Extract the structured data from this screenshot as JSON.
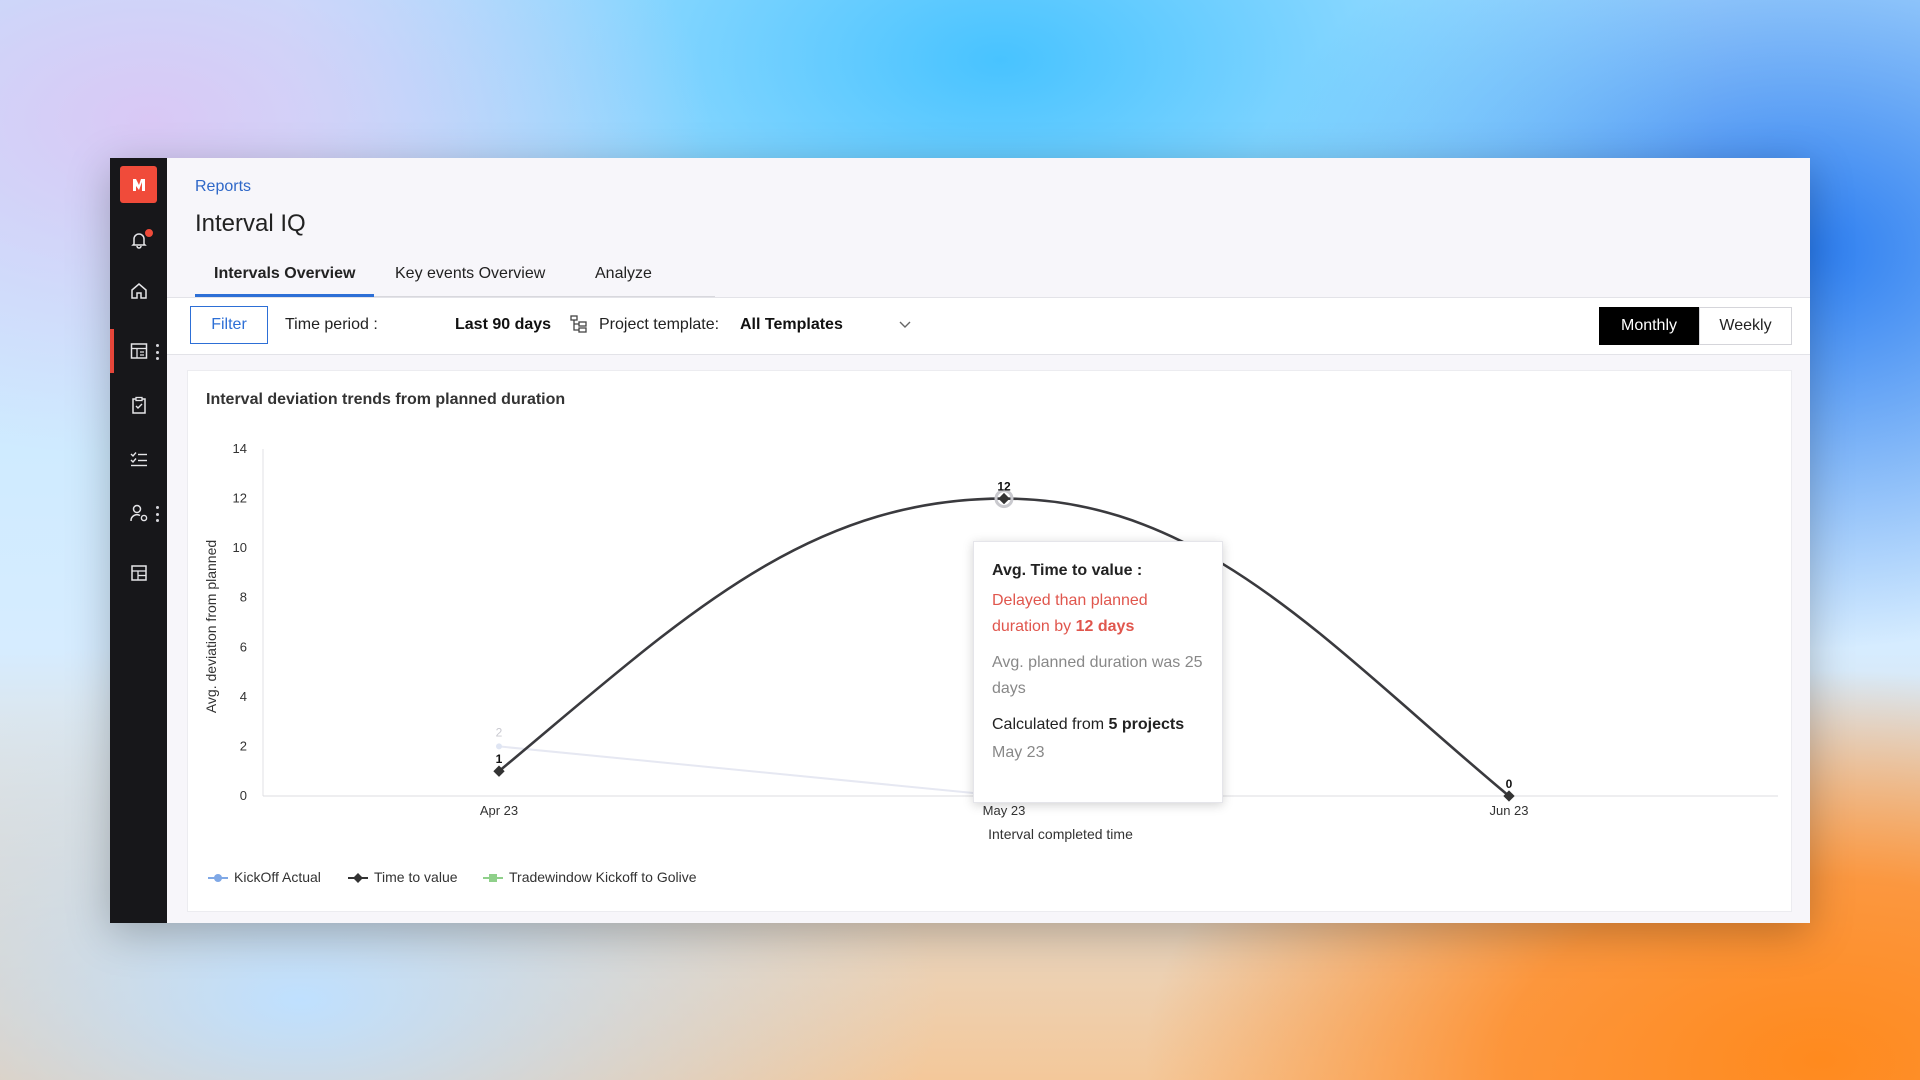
{
  "app": {
    "breadcrumb": "Reports",
    "title": "Interval IQ"
  },
  "tabs": [
    {
      "label": "Intervals Overview",
      "active": true
    },
    {
      "label": "Key events Overview",
      "active": false
    },
    {
      "label": "Analyze",
      "active": false
    }
  ],
  "toolbar": {
    "filter_label": "Filter",
    "time_period_label": "Time period :",
    "time_period_value": "Last 90 days",
    "template_label": "Project template:",
    "template_value": "All Templates",
    "view_monthly": "Monthly",
    "view_weekly": "Weekly",
    "selected_view": "Monthly"
  },
  "sidebar": {
    "icons": [
      "logo-icon",
      "bell-icon",
      "home-icon",
      "reports-icon",
      "clipboard-icon",
      "checklist-icon",
      "user-settings-icon",
      "layout-icon"
    ],
    "active": "reports-icon"
  },
  "colors": {
    "accent": "#2d6fd6",
    "brand": "#f04b3a",
    "delayed": "#e0564d",
    "series_time_to_value": "#333333",
    "series_kickoff_actual": "#7fa8e6",
    "series_tradewindow": "#8fd08a"
  },
  "chart_data": {
    "type": "line",
    "title": "Interval deviation trends from planned duration",
    "xlabel": "Interval completed time",
    "ylabel": "Avg. deviation from planned",
    "categories": [
      "Apr 23",
      "May 23",
      "Jun 23"
    ],
    "ylim": [
      0,
      14
    ],
    "yticks": [
      0,
      2,
      4,
      6,
      8,
      10,
      12,
      14
    ],
    "grid": false,
    "legend_position": "bottom-left",
    "series": [
      {
        "name": "KickOff Actual",
        "values": [
          2,
          0,
          null
        ],
        "color": "#7fa8e6",
        "dimmed": true
      },
      {
        "name": "Time to value",
        "values": [
          1,
          12,
          0
        ],
        "color": "#333333",
        "dimmed": false
      },
      {
        "name": "Tradewindow Kickoff to Golive",
        "values": [
          null,
          null,
          null
        ],
        "color": "#8fd08a",
        "dimmed": true
      }
    ],
    "data_labels": {
      "Time to value": [
        "1",
        "12",
        "0"
      ],
      "KickOff Actual": [
        "2",
        "",
        ""
      ]
    }
  },
  "tooltip": {
    "heading": "Avg. Time to value :",
    "delay_text": "Delayed than planned duration by",
    "delay_value": "12 days",
    "planned_text": "Avg. planned duration was 25 days",
    "calc_text": "Calculated from",
    "calc_value": "5 projects",
    "period": "May 23"
  }
}
